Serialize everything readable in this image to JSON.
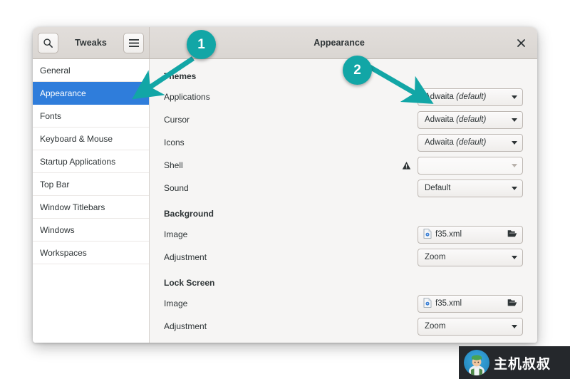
{
  "window": {
    "app_name": "Tweaks",
    "page_title": "Appearance",
    "close_label": "×",
    "search_icon": "search-icon",
    "menu_icon": "hamburger-menu-icon"
  },
  "sidebar": {
    "items": [
      {
        "label": "General",
        "selected": false
      },
      {
        "label": "Appearance",
        "selected": true
      },
      {
        "label": "Fonts",
        "selected": false
      },
      {
        "label": "Keyboard & Mouse",
        "selected": false
      },
      {
        "label": "Startup Applications",
        "selected": false
      },
      {
        "label": "Top Bar",
        "selected": false
      },
      {
        "label": "Window Titlebars",
        "selected": false
      },
      {
        "label": "Windows",
        "selected": false
      },
      {
        "label": "Workspaces",
        "selected": false
      }
    ]
  },
  "main": {
    "groups": [
      {
        "title": "Themes",
        "rows": [
          {
            "label": "Applications",
            "control": "combo",
            "value": "Adwaita",
            "value_italic": "(default)",
            "warning": false
          },
          {
            "label": "Cursor",
            "control": "combo",
            "value": "Adwaita",
            "value_italic": "(default)",
            "warning": false
          },
          {
            "label": "Icons",
            "control": "combo",
            "value": "Adwaita",
            "value_italic": "(default)",
            "warning": false
          },
          {
            "label": "Shell",
            "control": "combo",
            "value": "",
            "value_italic": "",
            "warning": true
          },
          {
            "label": "Sound",
            "control": "combo",
            "value": "Default",
            "value_italic": "",
            "warning": false
          }
        ]
      },
      {
        "title": "Background",
        "rows": [
          {
            "label": "Image",
            "control": "file",
            "value": "f35.xml",
            "warning": false
          },
          {
            "label": "Adjustment",
            "control": "combo",
            "value": "Zoom",
            "value_italic": "",
            "warning": false
          }
        ]
      },
      {
        "title": "Lock Screen",
        "rows": [
          {
            "label": "Image",
            "control": "file",
            "value": "f35.xml",
            "warning": false
          },
          {
            "label": "Adjustment",
            "control": "combo",
            "value": "Zoom",
            "value_italic": "",
            "warning": false
          }
        ]
      }
    ]
  },
  "annotations": {
    "color": "#12a6a6",
    "badges": [
      {
        "number": "1",
        "points_to": "sidebar-item-appearance"
      },
      {
        "number": "2",
        "points_to": "applications-theme-combo"
      }
    ]
  },
  "watermark": {
    "text": "主机叔叔"
  }
}
